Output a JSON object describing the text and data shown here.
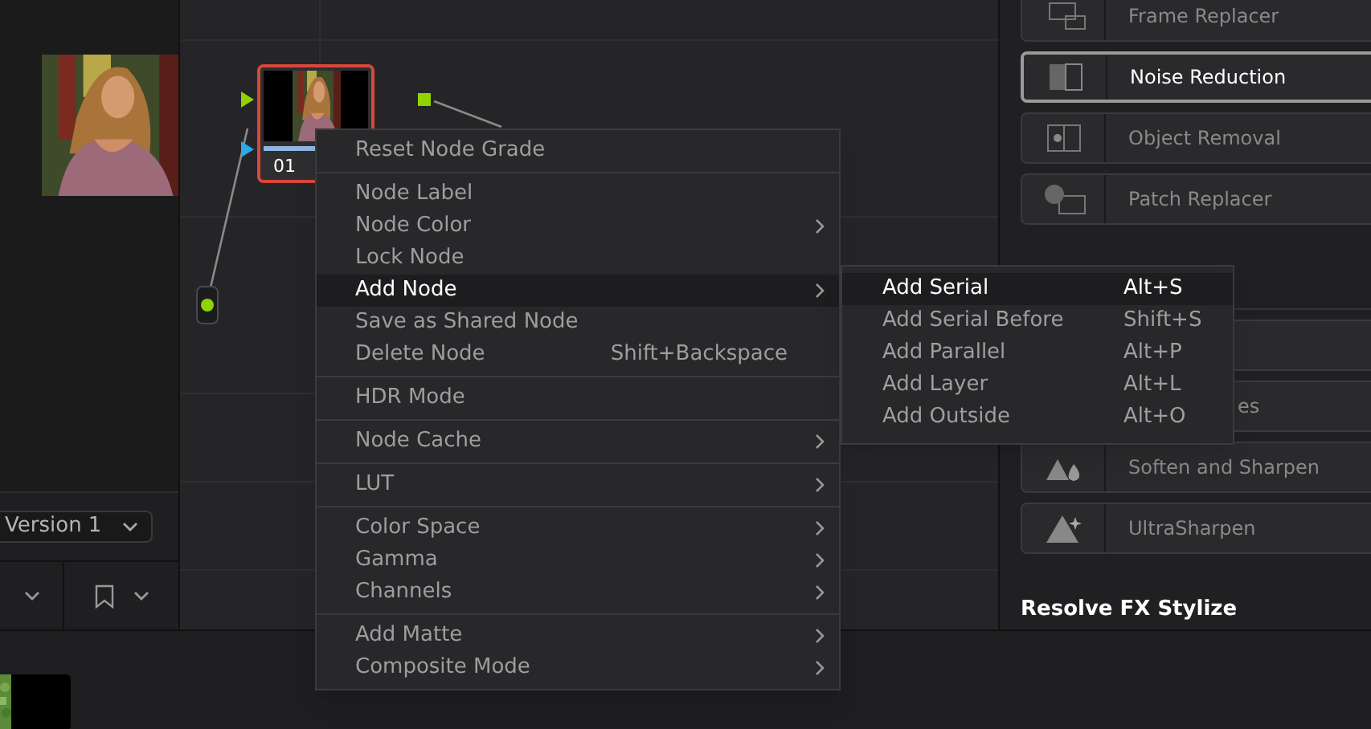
{
  "viewer": {
    "version_dropdown": "Version 1"
  },
  "node_editor": {
    "nodes": [
      {
        "label": "01",
        "selected": true
      }
    ]
  },
  "context_menu": {
    "sections": [
      {
        "items": [
          {
            "label": "Reset Node Grade",
            "submenu": false,
            "selected": false
          }
        ]
      },
      {
        "items": [
          {
            "label": "Node Label",
            "submenu": false,
            "selected": false
          },
          {
            "label": "Node Color",
            "submenu": true,
            "selected": false
          },
          {
            "label": "Lock Node",
            "submenu": false,
            "selected": false
          },
          {
            "label": "Add Node",
            "submenu": true,
            "selected": true
          },
          {
            "label": "Save as Shared Node",
            "submenu": false,
            "selected": false
          },
          {
            "label": "Delete Node",
            "shortcut": "Shift+Backspace",
            "submenu": false,
            "selected": false
          }
        ]
      },
      {
        "items": [
          {
            "label": "HDR Mode",
            "submenu": false,
            "selected": false
          }
        ]
      },
      {
        "items": [
          {
            "label": "Node Cache",
            "submenu": true,
            "selected": false
          }
        ]
      },
      {
        "items": [
          {
            "label": "LUT",
            "submenu": true,
            "selected": false
          }
        ]
      },
      {
        "items": [
          {
            "label": "Color Space",
            "submenu": true,
            "selected": false
          },
          {
            "label": "Gamma",
            "submenu": true,
            "selected": false
          },
          {
            "label": "Channels",
            "submenu": true,
            "selected": false
          }
        ]
      },
      {
        "items": [
          {
            "label": "Add Matte",
            "submenu": true,
            "selected": false
          },
          {
            "label": "Composite Mode",
            "submenu": true,
            "selected": false
          }
        ]
      }
    ]
  },
  "submenu": {
    "items": [
      {
        "label": "Add Serial",
        "shortcut": "Alt+S",
        "selected": true
      },
      {
        "label": "Add Serial Before",
        "shortcut": "Shift+S",
        "selected": false
      },
      {
        "label": "Add Parallel",
        "shortcut": "Alt+P",
        "selected": false
      },
      {
        "label": "Add Layer",
        "shortcut": "Alt+L",
        "selected": false
      },
      {
        "label": "Add Outside",
        "shortcut": "Alt+O",
        "selected": false
      }
    ]
  },
  "effects": {
    "groups": [
      {
        "items": [
          {
            "label": "Frame Replacer",
            "kind": "full",
            "selected": false
          },
          {
            "label": "Noise Reduction",
            "kind": "full",
            "selected": true
          },
          {
            "label": "Object Removal",
            "kind": "full",
            "selected": false
          },
          {
            "label": "Patch Replacer",
            "kind": "full",
            "selected": false
          }
        ]
      },
      {
        "items": [
          {
            "kind": "partial",
            "selected": false
          },
          {
            "label": "es",
            "kind": "partial",
            "selected": false
          },
          {
            "label": "Soften and Sharpen",
            "kind": "full",
            "selected": false
          },
          {
            "label": "UltraSharpen",
            "kind": "full",
            "selected": false
          }
        ]
      }
    ],
    "section_title": "Resolve FX Stylize"
  }
}
